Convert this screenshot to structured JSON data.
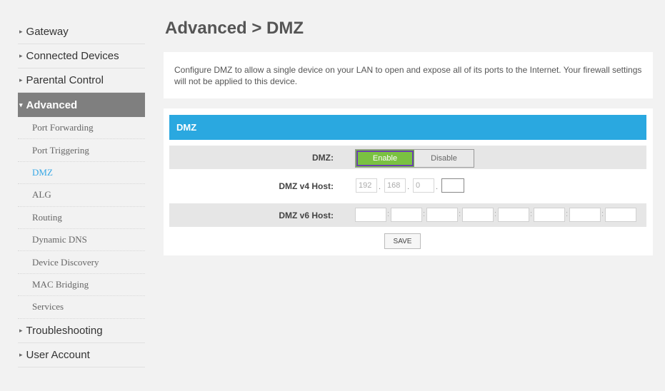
{
  "sidebar": {
    "items": [
      {
        "label": "Gateway"
      },
      {
        "label": "Connected Devices"
      },
      {
        "label": "Parental Control"
      },
      {
        "label": "Advanced"
      },
      {
        "label": "Troubleshooting"
      },
      {
        "label": "User Account"
      }
    ],
    "advanced_sub": [
      {
        "label": "Port Forwarding"
      },
      {
        "label": "Port Triggering"
      },
      {
        "label": "DMZ"
      },
      {
        "label": "ALG"
      },
      {
        "label": "Routing"
      },
      {
        "label": "Dynamic DNS"
      },
      {
        "label": "Device Discovery"
      },
      {
        "label": "MAC Bridging"
      },
      {
        "label": "Services"
      }
    ]
  },
  "main": {
    "title": "Advanced > DMZ",
    "description": "Configure DMZ to allow a single device on your LAN to open and expose all of its ports to the Internet. Your firewall settings will not be applied to this device.",
    "panel_title": "DMZ",
    "dmz_label": "DMZ:",
    "enable_label": "Enable",
    "disable_label": "Disable",
    "v4_label": "DMZ v4 Host:",
    "v4_octets": [
      "192",
      "168",
      "0",
      ""
    ],
    "v6_label": "DMZ v6 Host:",
    "save_label": "SAVE"
  },
  "colors": {
    "accent": "#2aa8e0",
    "enable_green": "#7ac142",
    "active_nav": "#7f7f7f",
    "current_sub": "#37a8e6"
  }
}
